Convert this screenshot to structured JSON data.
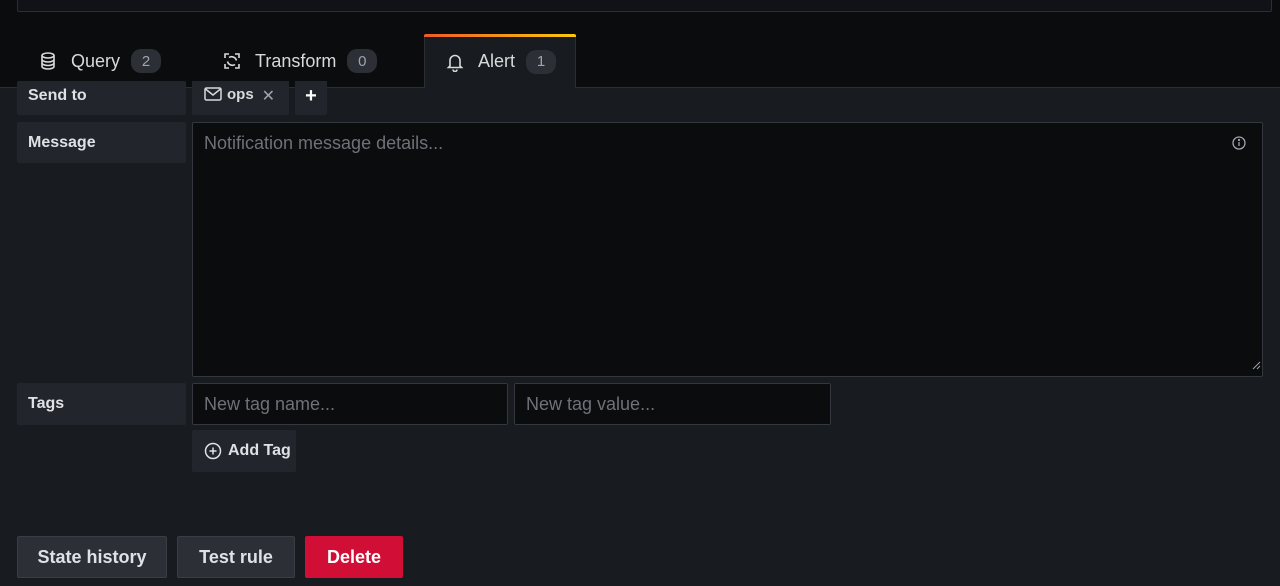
{
  "tabs": [
    {
      "label": "Query",
      "count": "2",
      "icon": "database-icon"
    },
    {
      "label": "Transform",
      "count": "0",
      "icon": "transform-icon"
    },
    {
      "label": "Alert",
      "count": "1",
      "icon": "bell-icon",
      "active": true
    }
  ],
  "form": {
    "send_to_label": "Send to",
    "recipient": {
      "name": "ops",
      "icon": "envelope-icon"
    },
    "add_recipient_label": "+",
    "message_label": "Message",
    "message_value": "",
    "message_placeholder": "Notification message details...",
    "tags_label": "Tags",
    "tag_name_placeholder": "New tag name...",
    "tag_value_placeholder": "New tag value...",
    "add_tag_label": "Add Tag"
  },
  "actions": {
    "state_history": "State history",
    "test_rule": "Test rule",
    "delete": "Delete"
  },
  "colors": {
    "background": "#181b1f",
    "delete": "#d10e36",
    "active_tab_gradient_start": "#f05a28",
    "active_tab_gradient_end": "#fbca0a"
  }
}
